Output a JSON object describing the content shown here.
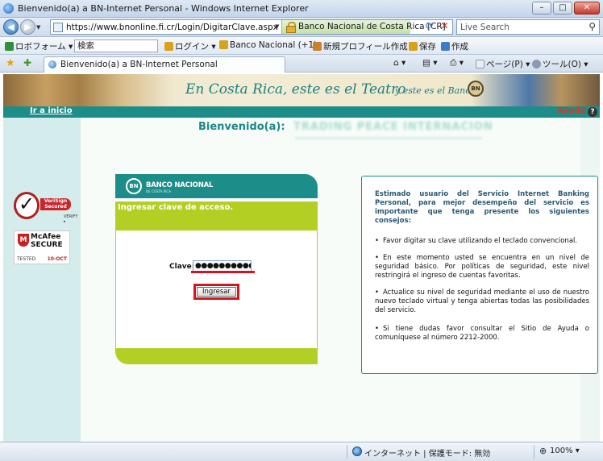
{
  "browser": {
    "window_title": "Bienvenido(a) a BN-Internet Personal - Windows Internet Explorer",
    "window_buttons": {
      "minimize": "–",
      "maximize": "□",
      "close": "✕"
    },
    "url": "https://www.bnonline.fi.cr/Login/DigitarClave.aspx",
    "security_label": "Banco Nacional de Costa Rica [CR]",
    "search_placeholder": "Live Search",
    "toolbar": {
      "links_label": "ロボフォーム ▾",
      "search_field": "検索",
      "login_label": "ログイン ▾",
      "bank_link": "Banco Nacional (+1)",
      "new_profile": "新規プロフィール作成",
      "save_label": "保存",
      "create_label": "作成"
    },
    "tab_label": "Bienvenido(a) a BN-Internet Personal",
    "command_bar": {
      "page_menu": "ページ(P) ▾",
      "tools_menu": "ツール(O) ▾"
    }
  },
  "page": {
    "banner_slogan": "En Costa Rica, este es el Teatro",
    "banner_slogan2": "y este es el Banco.",
    "banner_logo": "BN",
    "home_link": "Ir a inicio",
    "help_link": "Ayuda",
    "welcome_label": "Bienvenido(a):",
    "client_name": "TRADING PEACE INTERNACION",
    "seals": {
      "verisign_text": "VeriSign\nSecured",
      "verisign_verify": "VERIFY ▸",
      "mcafee_name": "McAfee",
      "mcafee_secure": "SECURE",
      "mcafee_tested": "TESTED",
      "mcafee_date": "10-OCT"
    },
    "card": {
      "bank_emblem": "BN",
      "bank_name": "BANCO NACIONAL",
      "bank_sub": "DE COSTA RICA",
      "heading": "Ingresar clave de acceso.",
      "password_label": "Clave:",
      "password_value": "●●●●●●●●●●●●●●●●",
      "submit_label": "Ingresar"
    },
    "tips": {
      "intro": "Estimado usuario del Servicio Internet Banking Personal, para mejor desempeño del servicio es importante que tenga presente los siguientes consejos:",
      "items": [
        "Favor digitar su clave utilizando el teclado convencional.",
        "En este momento usted se encuentra en un nivel de seguridad básico. Por políticas de seguridad, este nivel restringirá el ingreso de cuentas favoritas.",
        "Actualice su nivel de seguridad mediante el uso de nuestro nuevo teclado virtual y tenga abiertas todas las posibilidades del servicio.",
        "Si tiene dudas favor consultar el Sitio de Ayuda o comuníquese al número 2212-2000."
      ]
    }
  },
  "status": {
    "zone": "インターネット | 保護モード: 無効",
    "zoom": "100% ▾"
  },
  "colors": {
    "brand_teal": "#1c8d89",
    "accent_green": "#b4cf24",
    "highlight_red": "#d2161f"
  }
}
